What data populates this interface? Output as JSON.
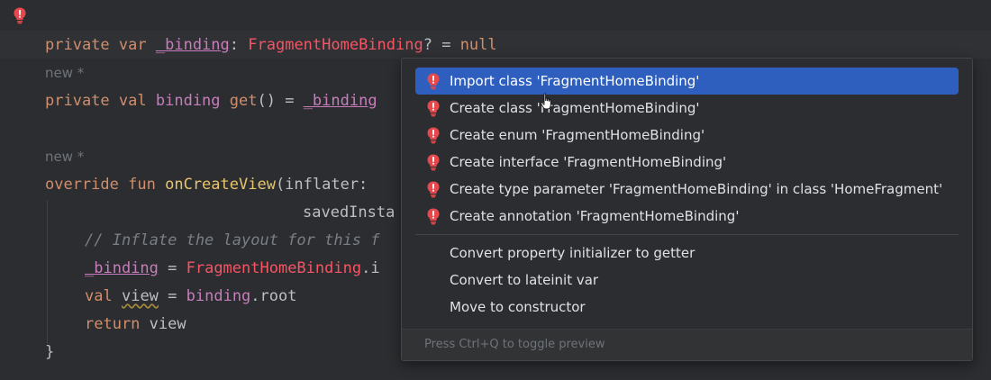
{
  "editor": {
    "line1": {
      "kw1": "private",
      "kw2": "var",
      "name": "_binding",
      "colon": ":",
      "type": "FragmentHomeBinding",
      "rest": "? = ",
      "null": "null"
    },
    "hint1": "new *",
    "line2": {
      "kw1": "private",
      "kw2": "val",
      "name": "binding",
      "get": "get",
      "paren": "() = ",
      "ref": "_binding"
    },
    "hint2": "new *",
    "line3": {
      "kw1": "override",
      "kw2": "fun",
      "fn": "onCreateView",
      "rest": "(inflater:"
    },
    "line4": {
      "text": "savedInsta"
    },
    "line5": {
      "comment": "// Inflate the layout for this f"
    },
    "line6": {
      "name": "_binding",
      "eq": " = ",
      "type": "FragmentHomeBinding",
      "rest": ".i"
    },
    "line7": {
      "kw": "val",
      "name": "view",
      "eq": " = ",
      "ref": "binding",
      "rest": ".root"
    },
    "line8": {
      "kw": "return",
      "rest": " view"
    },
    "line9": {
      "text": "}"
    }
  },
  "popup": {
    "items": [
      {
        "label": "Import class 'FragmentHomeBinding'",
        "icon": "error-bulb-icon",
        "selected": true
      },
      {
        "label": "Create class 'FragmentHomeBinding'",
        "icon": "error-bulb-icon"
      },
      {
        "label": "Create enum 'FragmentHomeBinding'",
        "icon": "error-bulb-icon"
      },
      {
        "label": "Create interface 'FragmentHomeBinding'",
        "icon": "error-bulb-icon"
      },
      {
        "label": "Create type parameter 'FragmentHomeBinding' in class 'HomeFragment'",
        "icon": "error-bulb-icon"
      },
      {
        "label": "Create annotation 'FragmentHomeBinding'",
        "icon": "error-bulb-icon"
      },
      {
        "label": "Convert property initializer to getter"
      },
      {
        "label": "Convert to lateinit var"
      },
      {
        "label": "Move to constructor"
      }
    ],
    "footer": "Press Ctrl+Q to toggle preview"
  },
  "colors": {
    "selection": "#2e5fbf",
    "error": "#f75464",
    "keyword": "#cf8e6d",
    "property": "#c77dbb"
  }
}
